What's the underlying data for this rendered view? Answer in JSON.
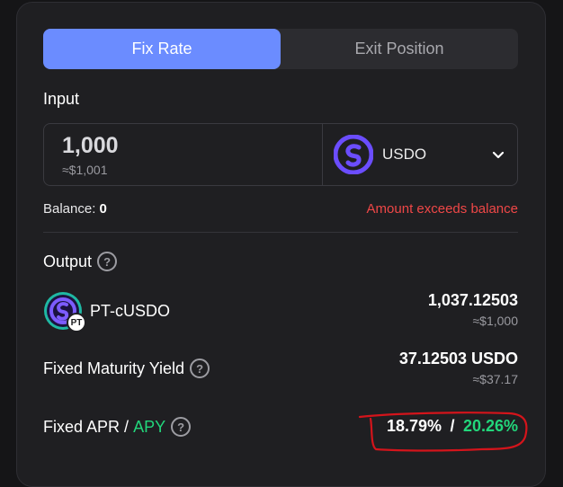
{
  "tabs": [
    {
      "label": "Fix Rate",
      "active": true
    },
    {
      "label": "Exit Position",
      "active": false
    }
  ],
  "input": {
    "section_label": "Input",
    "amount": "1,000",
    "amount_usd": "≈$1,001",
    "token": "USDO",
    "token_icon": "usdo-logo-icon"
  },
  "balance": {
    "label": "Balance:",
    "value": "0",
    "error": "Amount exceeds balance"
  },
  "output": {
    "section_label": "Output",
    "token": "PT-cUSDO",
    "token_badge": "PT",
    "amount": "1,037.12503",
    "amount_usd": "≈$1,000"
  },
  "yield": {
    "label": "Fixed Maturity Yield",
    "value": "37.12503 USDO",
    "value_usd": "≈$37.17"
  },
  "apr": {
    "label_apr": "Fixed APR",
    "label_sep": " / ",
    "label_apy": "APY",
    "apr_value": "18.79%",
    "sep": " / ",
    "apy_value": "20.26%"
  },
  "colors": {
    "accent": "#6b8cff",
    "error": "#ef4747",
    "positive": "#22d67b",
    "token_purple": "#6b4dff",
    "annotation": "#d4141b"
  }
}
